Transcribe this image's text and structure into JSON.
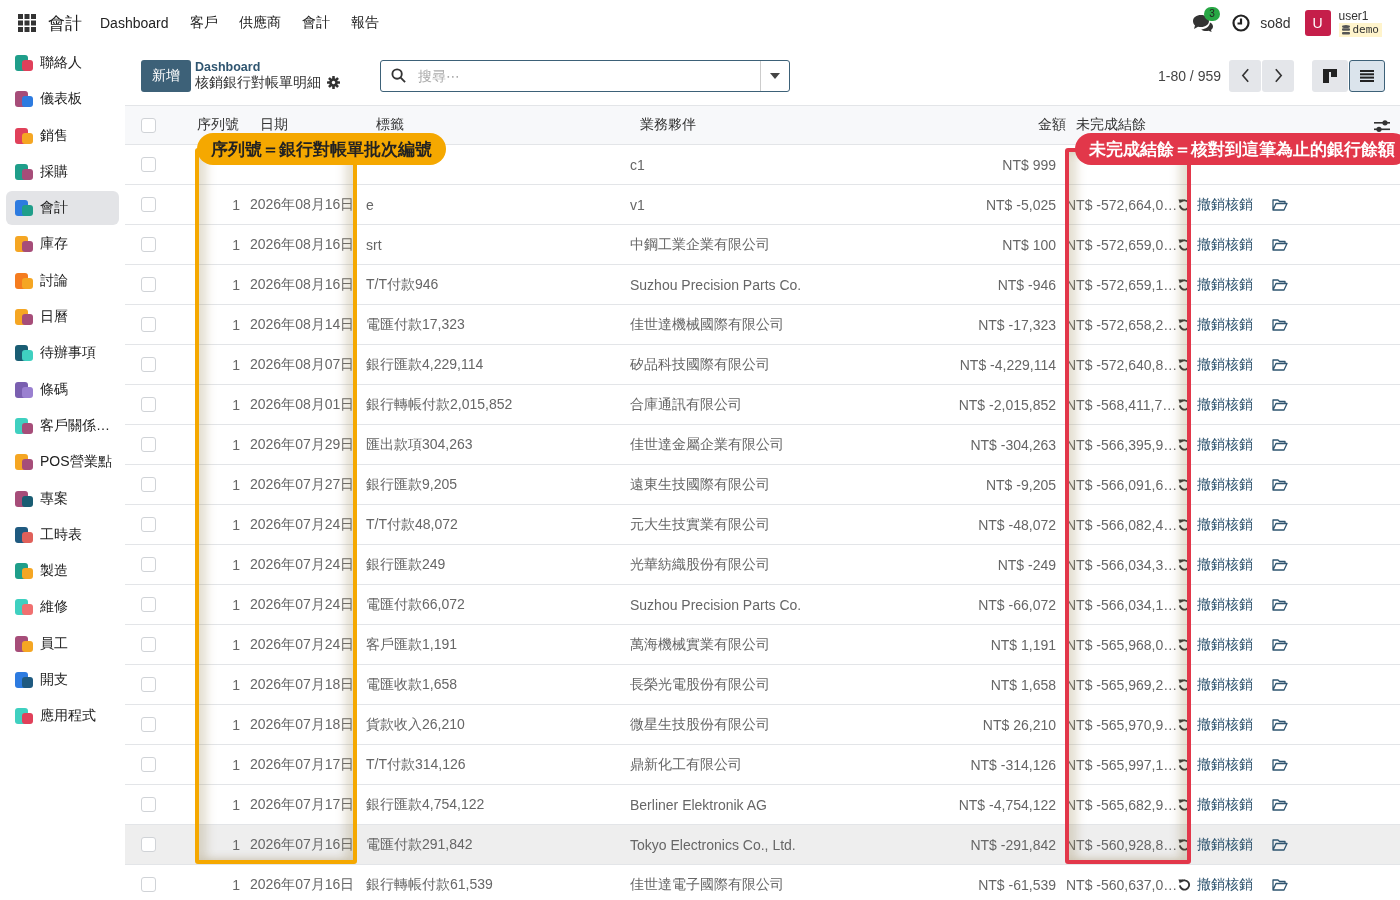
{
  "top_bar": {
    "app_name": "會計",
    "menu": [
      "Dashboard",
      "客戶",
      "供應商",
      "會計",
      "報告"
    ],
    "messages_count": "3",
    "company": "so8d",
    "avatar_letter": "U",
    "user": "user1",
    "database": "demo"
  },
  "sidebar": {
    "items": [
      {
        "label": "聯絡人",
        "selected": false
      },
      {
        "label": "儀表板",
        "selected": false
      },
      {
        "label": "銷售",
        "selected": false
      },
      {
        "label": "採購",
        "selected": false
      },
      {
        "label": "會計",
        "selected": true
      },
      {
        "label": "庫存",
        "selected": false
      },
      {
        "label": "討論",
        "selected": false
      },
      {
        "label": "日曆",
        "selected": false
      },
      {
        "label": "待辦事項",
        "selected": false
      },
      {
        "label": "條碼",
        "selected": false
      },
      {
        "label": "客戶關係…",
        "selected": false
      },
      {
        "label": "POS營業點",
        "selected": false
      },
      {
        "label": "專案",
        "selected": false
      },
      {
        "label": "工時表",
        "selected": false
      },
      {
        "label": "製造",
        "selected": false
      },
      {
        "label": "維修",
        "selected": false
      },
      {
        "label": "員工",
        "selected": false
      },
      {
        "label": "開支",
        "selected": false
      },
      {
        "label": "應用程式",
        "selected": false
      }
    ]
  },
  "control_panel": {
    "new_button": "新增",
    "breadcrumb": "Dashboard",
    "title": "核銷銀行對帳單明細",
    "search_placeholder": "搜尋⋯",
    "pager": "1-80 / 959",
    "views": [
      {
        "kind": "kanban",
        "selected": false
      },
      {
        "kind": "list",
        "selected": true
      }
    ]
  },
  "table": {
    "select_all_checked": false,
    "columns": [
      "序列號",
      "日期",
      "標籤",
      "業務夥伴",
      "金額",
      "未完成結餘"
    ],
    "rows": [
      {
        "partner": "c1",
        "amount": "NT$ 999",
        "highlighted": false
      },
      {
        "seq": "1",
        "date": "2026年08月16日",
        "label": "e",
        "partner": "v1",
        "amount": "NT$ -5,025",
        "balance": "NT$ -572,664,0…",
        "action": "撤銷核銷",
        "highlighted": false
      },
      {
        "seq": "1",
        "date": "2026年08月16日",
        "label": "srt",
        "partner": "中鋼工業企業有限公司",
        "amount": "NT$ 100",
        "balance": "NT$ -572,659,0…",
        "action": "撤銷核銷",
        "highlighted": false
      },
      {
        "seq": "1",
        "date": "2026年08月16日",
        "label": "T/T付款946",
        "partner": "Suzhou Precision Parts Co.",
        "amount": "NT$ -946",
        "balance": "NT$ -572,659,1…",
        "action": "撤銷核銷",
        "highlighted": false
      },
      {
        "seq": "1",
        "date": "2026年08月14日",
        "label": "電匯付款17,323",
        "partner": "佳世達機械國際有限公司",
        "amount": "NT$ -17,323",
        "balance": "NT$ -572,658,2…",
        "action": "撤銷核銷",
        "highlighted": false
      },
      {
        "seq": "1",
        "date": "2026年08月07日",
        "label": "銀行匯款4,229,114",
        "partner": "矽品科技國際有限公司",
        "amount": "NT$ -4,229,114",
        "balance": "NT$ -572,640,8…",
        "action": "撤銷核銷",
        "highlighted": false
      },
      {
        "seq": "1",
        "date": "2026年08月01日",
        "label": "銀行轉帳付款2,015,852",
        "partner": "合庫通訊有限公司",
        "amount": "NT$ -2,015,852",
        "balance": "NT$ -568,411,7…",
        "action": "撤銷核銷",
        "highlighted": false
      },
      {
        "seq": "1",
        "date": "2026年07月29日",
        "label": "匯出款項304,263",
        "partner": "佳世達金屬企業有限公司",
        "amount": "NT$ -304,263",
        "balance": "NT$ -566,395,9…",
        "action": "撤銷核銷",
        "highlighted": false
      },
      {
        "seq": "1",
        "date": "2026年07月27日",
        "label": "銀行匯款9,205",
        "partner": "遠東生技國際有限公司",
        "amount": "NT$ -9,205",
        "balance": "NT$ -566,091,6…",
        "action": "撤銷核銷",
        "highlighted": false
      },
      {
        "seq": "1",
        "date": "2026年07月24日",
        "label": "T/T付款48,072",
        "partner": "元大生技實業有限公司",
        "amount": "NT$ -48,072",
        "balance": "NT$ -566,082,4…",
        "action": "撤銷核銷",
        "highlighted": false
      },
      {
        "seq": "1",
        "date": "2026年07月24日",
        "label": "銀行匯款249",
        "partner": "光華紡織股份有限公司",
        "amount": "NT$ -249",
        "balance": "NT$ -566,034,3…",
        "action": "撤銷核銷",
        "highlighted": false
      },
      {
        "seq": "1",
        "date": "2026年07月24日",
        "label": "電匯付款66,072",
        "partner": "Suzhou Precision Parts Co.",
        "amount": "NT$ -66,072",
        "balance": "NT$ -566,034,1…",
        "action": "撤銷核銷",
        "highlighted": false
      },
      {
        "seq": "1",
        "date": "2026年07月24日",
        "label": "客戶匯款1,191",
        "partner": "萬海機械實業有限公司",
        "amount": "NT$ 1,191",
        "balance": "NT$ -565,968,0…",
        "action": "撤銷核銷",
        "highlighted": false
      },
      {
        "seq": "1",
        "date": "2026年07月18日",
        "label": "電匯收款1,658",
        "partner": "長榮光電股份有限公司",
        "amount": "NT$ 1,658",
        "balance": "NT$ -565,969,2…",
        "action": "撤銷核銷",
        "highlighted": false
      },
      {
        "seq": "1",
        "date": "2026年07月18日",
        "label": "貨款收入26,210",
        "partner": "微星生技股份有限公司",
        "amount": "NT$ 26,210",
        "balance": "NT$ -565,970,9…",
        "action": "撤銷核銷",
        "highlighted": false
      },
      {
        "seq": "1",
        "date": "2026年07月17日",
        "label": "T/T付款314,126",
        "partner": "鼎新化工有限公司",
        "amount": "NT$ -314,126",
        "balance": "NT$ -565,997,1…",
        "action": "撤銷核銷",
        "highlighted": false
      },
      {
        "seq": "1",
        "date": "2026年07月17日",
        "label": "銀行匯款4,754,122",
        "partner": "Berliner Elektronik AG",
        "amount": "NT$ -4,754,122",
        "balance": "NT$ -565,682,9…",
        "action": "撤銷核銷",
        "highlighted": false
      },
      {
        "seq": "1",
        "date": "2026年07月16日",
        "label": "電匯付款291,842",
        "partner": "Tokyo Electronics Co., Ltd.",
        "amount": "NT$ -291,842",
        "balance": "NT$ -560,928,8…",
        "action": "撤銷核銷",
        "highlighted": true
      },
      {
        "seq": "1",
        "date": "2026年07月16日",
        "label": "銀行轉帳付款61,539",
        "partner": "佳世達電子國際有限公司",
        "amount": "NT$ -61,539",
        "balance": "NT$ -560,637,0…",
        "action": "撤銷核銷",
        "highlighted": false
      }
    ]
  },
  "annotations": [
    {
      "text": "序列號＝銀行對帳單批次編號",
      "color": "#f5a800"
    },
    {
      "text": "未完成結餘＝核對到這筆為止的銀行餘額",
      "color": "#e2374a"
    }
  ]
}
